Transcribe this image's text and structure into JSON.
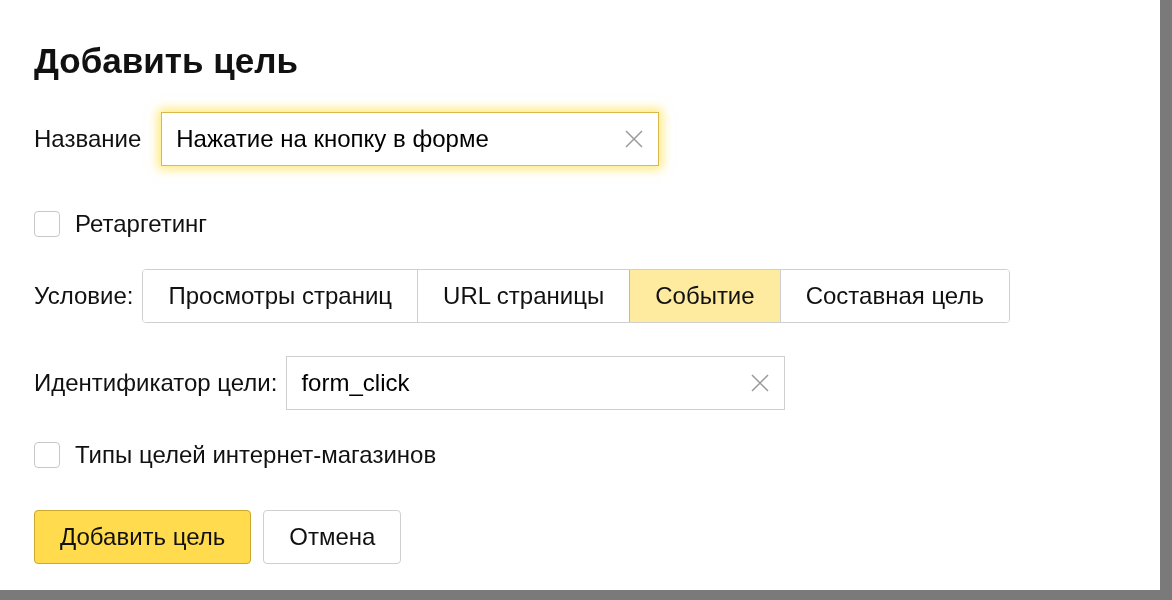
{
  "dialog": {
    "title": "Добавить цель"
  },
  "name_field": {
    "label": "Название",
    "value": "Нажатие на кнопку в форме",
    "focused": true
  },
  "retargeting": {
    "label": "Ретаргетинг",
    "checked": false
  },
  "condition": {
    "label": "Условие:",
    "options": [
      {
        "label": "Просмотры страниц",
        "selected": false
      },
      {
        "label": "URL страницы",
        "selected": false
      },
      {
        "label": "Событие",
        "selected": true
      },
      {
        "label": "Составная цель",
        "selected": false
      }
    ]
  },
  "goal_id_field": {
    "label": "Идентификатор цели:",
    "value": "form_click",
    "focused": false
  },
  "shop_goal_types": {
    "label": "Типы целей интернет-магазинов",
    "checked": false
  },
  "buttons": [
    {
      "label": "Добавить цель",
      "kind": "primary"
    },
    {
      "label": "Отмена",
      "kind": "secondary"
    }
  ]
}
